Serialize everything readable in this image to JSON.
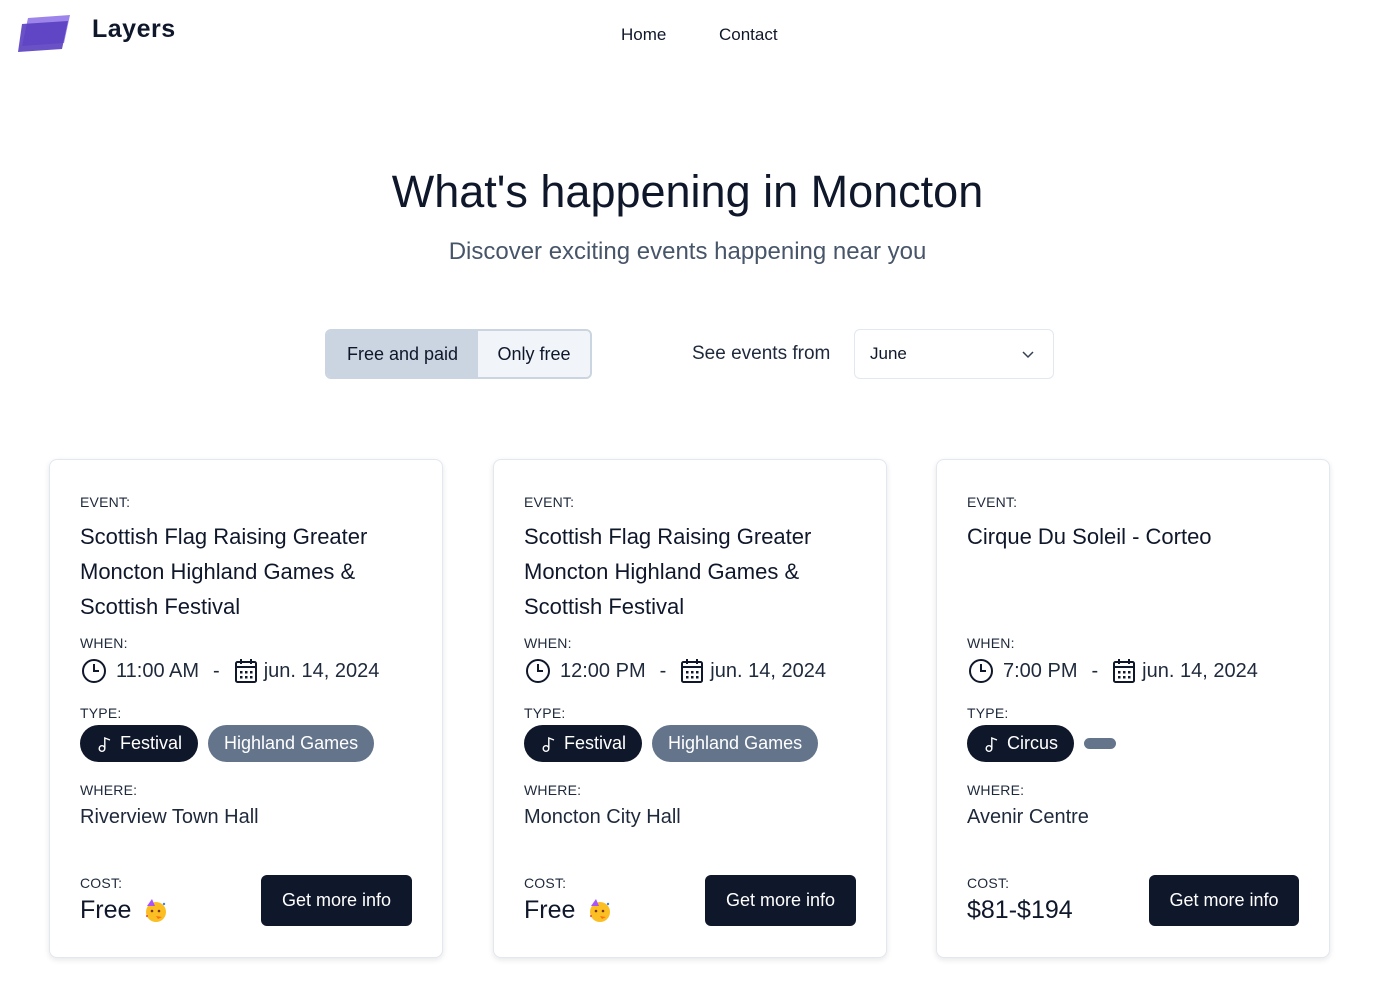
{
  "header": {
    "brand": "Layers",
    "nav": {
      "home": "Home",
      "contact": "Contact"
    }
  },
  "hero": {
    "title": "What's happening in Moncton",
    "subtitle": "Discover exciting events happening near you"
  },
  "filters": {
    "toggle": {
      "free_and_paid": "Free and paid",
      "only_free": "Only free",
      "selected": "Free and paid"
    },
    "events_from_label": "See events from",
    "month_selected": "June"
  },
  "labels": {
    "event": "EVENT:",
    "when": "WHEN:",
    "type": "TYPE:",
    "where": "WHERE:",
    "cost": "COST:",
    "button": "Get more info",
    "dash": "-"
  },
  "events": [
    {
      "title": "Scottish Flag Raising Greater Moncton Highland Games & Scottish Festival",
      "time": "11:00 AM",
      "date": "jun. 14, 2024",
      "primary_type": "Festival",
      "secondary_type": "Highland Games",
      "where": "Riverview Town Hall",
      "cost": "Free",
      "cost_icon": "party-face-icon"
    },
    {
      "title": "Scottish Flag Raising Greater Moncton Highland Games & Scottish Festival",
      "time": "12:00 PM",
      "date": "jun. 14, 2024",
      "primary_type": "Festival",
      "secondary_type": "Highland Games",
      "where": "Moncton City Hall",
      "cost": "Free",
      "cost_icon": "party-face-icon"
    },
    {
      "title": "Cirque Du Soleil - Corteo",
      "time": "7:00 PM",
      "date": "jun. 14, 2024",
      "primary_type": "Circus",
      "secondary_type": "",
      "where": "Avenir Centre",
      "cost": "$81-$194",
      "cost_icon": ""
    }
  ],
  "colors": {
    "primary": "#0f172a",
    "tag_gray": "#64748b",
    "toggle_active": "#cbd5e1",
    "logo_purple": "#6d4fd6"
  }
}
